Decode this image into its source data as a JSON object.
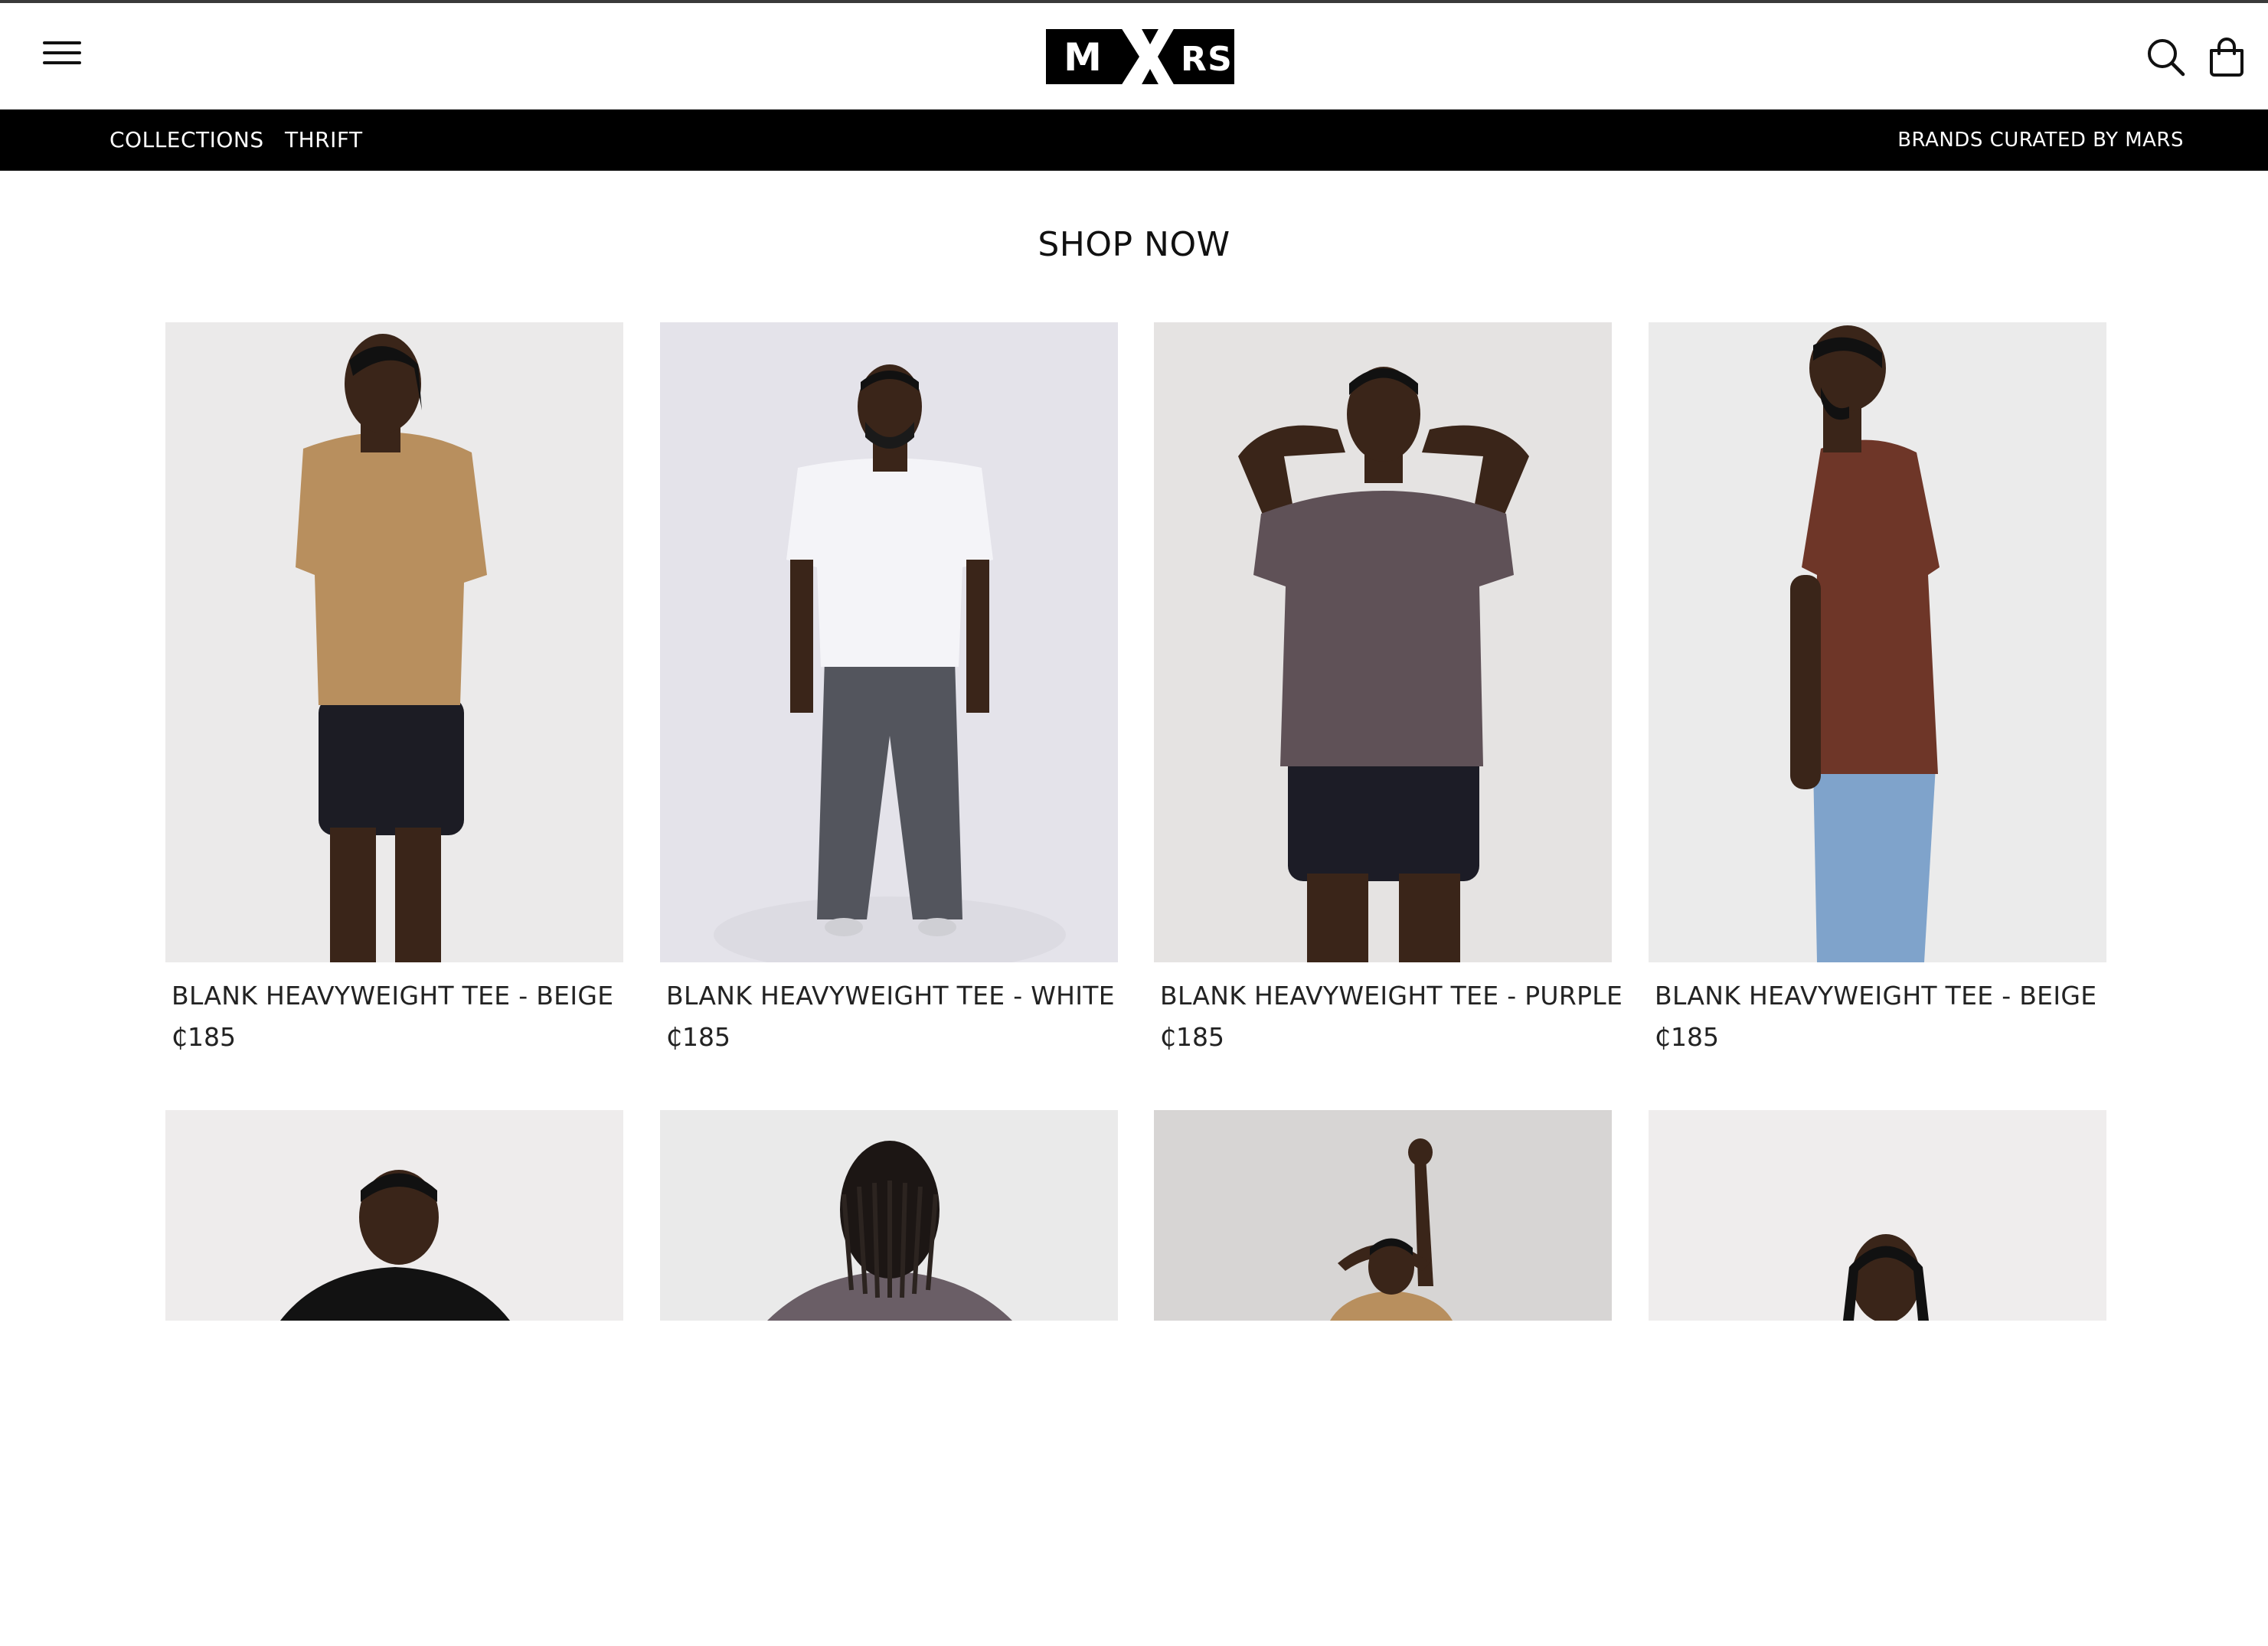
{
  "header": {
    "logo_text": "MXRS",
    "menu_icon": "hamburger-menu-icon",
    "search_icon": "search-icon",
    "cart_icon": "shopping-bag-icon"
  },
  "nav": {
    "items": [
      {
        "label": "COLLECTIONS"
      },
      {
        "label": "THRIFT"
      }
    ],
    "tagline": "BRANDS CURATED BY MARS"
  },
  "main": {
    "title": "SHOP NOW",
    "products": [
      {
        "name": "BLANK HEAVYWEIGHT TEE - BEIGE",
        "price": "₵185",
        "bg": "#ebeaea",
        "shirt": "#b88f5e",
        "bottom": "#1c1c24"
      },
      {
        "name": "BLANK HEAVYWEIGHT TEE - WHITE",
        "price": "₵185",
        "bg": "#e4e3ea",
        "shirt": "#f4f4f8",
        "bottom": "#53555d"
      },
      {
        "name": "BLANK HEAVYWEIGHT TEE - PURPLE",
        "price": "₵185",
        "bg": "#e5e3e2",
        "shirt": "#5f5157",
        "bottom": "#1c1c26"
      },
      {
        "name": "BLANK HEAVYWEIGHT TEE - BEIGE",
        "price": "₵185",
        "bg": "#ebebeb",
        "shirt": "#6e3628",
        "bottom": "#7fa3cb"
      }
    ],
    "products_row2": [
      {
        "bg": "#eeecec",
        "shirt": "#121212"
      },
      {
        "bg": "#eaeaea",
        "shirt": "#6a5e66"
      },
      {
        "bg": "#d7d5d4",
        "shirt": "#b88f5e"
      },
      {
        "bg": "#efeded",
        "shirt": "#b88f5e"
      }
    ]
  }
}
